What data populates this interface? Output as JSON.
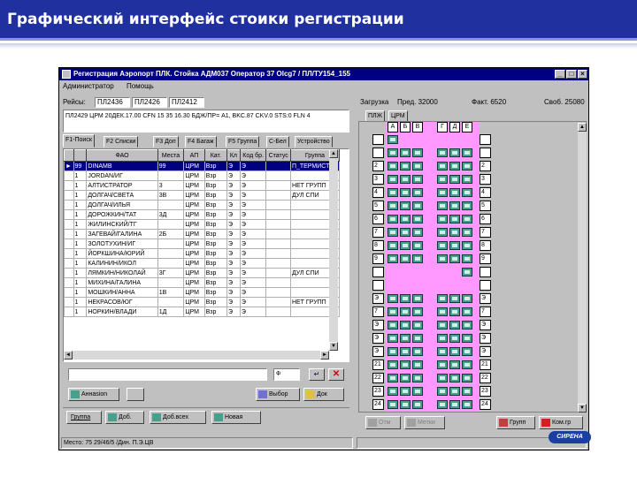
{
  "slide": {
    "title": "Графический интерфейс стоики регистрации"
  },
  "window": {
    "title": "Регистрация Аэропорт ПЛК. Стойка АДМ037 Оператор 37 Olcg7 / ПЛ/ТУ154_155",
    "menu": [
      "Администратор",
      "Помощь"
    ],
    "flights_label": "Рейсы:",
    "flights": [
      "ПЛ2436",
      "ПЛ2426",
      "ПЛ2412"
    ],
    "info_text": "ПЛ2429 ЦРМ 20ДЕК.17.00 CFN 15 35 16.30 БДЖ/ПР= A1, BKC.87 CKV.0 STS:0 FLN 4",
    "tabs": [
      "F1-Поиск",
      "F2 Списки",
      "F3 Доп",
      "F4 Багаж",
      "F5 Группа",
      "С-Бел",
      "Устройство"
    ],
    "columns": [
      "ФАО",
      "Места",
      "АП",
      "Кат.",
      "Кл",
      "Код бр.",
      "Статус",
      "Группа"
    ],
    "rows": [
      [
        "99",
        "DINAMB",
        "99",
        "ЦРМ",
        "Взр",
        "Э",
        "Э",
        "",
        "",
        "П_ТЕРМИСТЕ"
      ],
      [
        "1",
        "JORDAN/ИГ",
        "",
        "ЦРМ",
        "Взр",
        "Э",
        "Э",
        "",
        "",
        ""
      ],
      [
        "1",
        "АЛТИСТРАТОР",
        "3",
        "ЦРМ",
        "Взр",
        "Э",
        "Э",
        "",
        "",
        "НЕТ ГРУПП"
      ],
      [
        "1",
        "ДОЛГАЧ/СВЕТА",
        "3В",
        "ЦРМ",
        "Взр",
        "Э",
        "Э",
        "",
        "",
        "ДУЛ СПИ"
      ],
      [
        "1",
        "ДОЛГАЧ/ИЛЬЯ",
        "",
        "ЦРМ",
        "Взр",
        "Э",
        "Э",
        "",
        "",
        ""
      ],
      [
        "1",
        "ДОРОЖКИН/ТАТ",
        "3Д",
        "ЦРМ",
        "Взр",
        "Э",
        "Э",
        "",
        "",
        ""
      ],
      [
        "1",
        "ЖИЛИНСКИЙ/ТГ",
        "",
        "ЦРМ",
        "Взр",
        "Э",
        "Э",
        "",
        "",
        ""
      ],
      [
        "1",
        "ЗАГЕВАЙ/ГАЛИНА",
        "2Б",
        "ЦРМ",
        "Взр",
        "Э",
        "Э",
        "",
        "",
        ""
      ],
      [
        "1",
        "ЗОЛОТУХИН/ИГ",
        "",
        "ЦРМ",
        "Взр",
        "Э",
        "Э",
        "",
        "",
        ""
      ],
      [
        "1",
        "ЙОРКШИНА/ЮРИЙ",
        "",
        "ЦРМ",
        "Взр",
        "Э",
        "Э",
        "",
        "",
        ""
      ],
      [
        "1",
        "КАЛИНИН/ИКОЛ",
        "",
        "ЦРМ",
        "Взр",
        "Э",
        "Э",
        "",
        "",
        ""
      ],
      [
        "1",
        "ЛЯМКИН/НИКОЛАЙ",
        "3Г",
        "ЦРМ",
        "Взр",
        "Э",
        "Э",
        "",
        "",
        "ДУЛ СПИ"
      ],
      [
        "1",
        "МИХИНА/ГАЛИНА",
        "",
        "ЦРМ",
        "Взр",
        "Э",
        "Э",
        "",
        "",
        ""
      ],
      [
        "1",
        "МОШКИН/АННА",
        "1В",
        "ЦРМ",
        "Взр",
        "Э",
        "Э",
        "",
        "",
        ""
      ],
      [
        "1",
        "НЕКРАСОВ/ЮГ",
        "",
        "ЦРМ",
        "Взр",
        "Э",
        "Э",
        "",
        "",
        "НЕТ ГРУПП"
      ],
      [
        "1",
        "НОРКИН/ВЛАДИ",
        "1Д",
        "ЦРМ",
        "Взр",
        "Э",
        "Э",
        "",
        "",
        ""
      ]
    ],
    "search_value": "",
    "search_mode": "Ф",
    "buttons": {
      "boarding": "Аннаsion",
      "select": "Выбор",
      "doc": "Док",
      "group": "Группа",
      "add": "Доб.",
      "add_all": "Доб.всех",
      "new": "Новая"
    },
    "right_panel": {
      "loading_label": "Загрузка",
      "pred_label": "Пред. 32000",
      "fact_label": "Факт. 6520",
      "free_label": "Своб. 25080",
      "class_tabs": [
        "ПЛЖ",
        "ЦРМ"
      ],
      "seat_columns": [
        "А",
        "Б",
        "В",
        "",
        "Г",
        "Д",
        "Е"
      ],
      "row_labels": [
        "",
        "",
        "2",
        "3",
        "4",
        "5",
        "6",
        "7",
        "8",
        "9",
        "",
        "",
        "Э",
        "7",
        "Э",
        "Э",
        "Э",
        "21",
        "22",
        "23",
        "24"
      ],
      "right_row_labels": [
        "",
        "",
        "2",
        "3",
        "4",
        "5",
        "6",
        "7",
        "8",
        "9",
        "",
        "",
        "Э",
        "7",
        "Э",
        "Э",
        "Э",
        "21",
        "22",
        "23",
        "24"
      ]
    },
    "bottom_buttons": {
      "cancel": "Отм",
      "mark": "Метки",
      "group": "Групп",
      "remove": "Ком.гр"
    },
    "status_bar": "Место: 75 29/46/5 /Дин. П.Э.ЦВ",
    "logo_text": "СИРЕНА"
  }
}
